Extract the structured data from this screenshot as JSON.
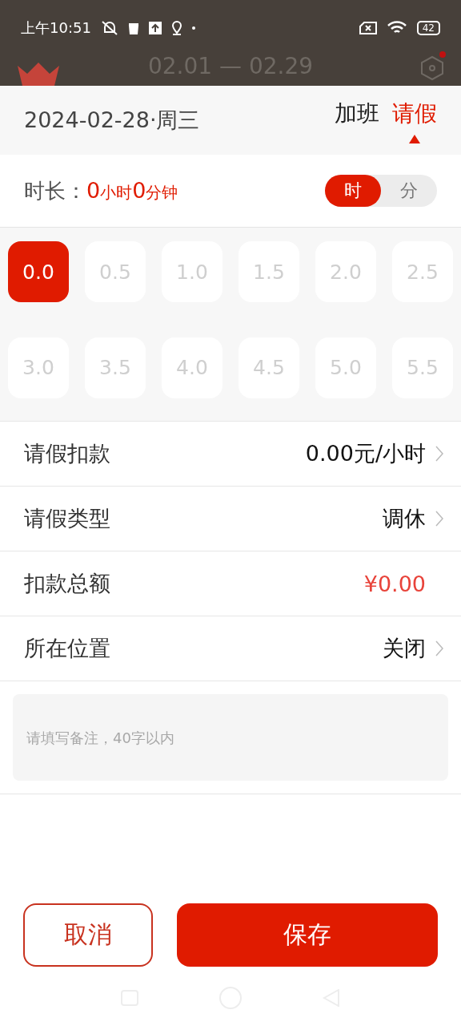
{
  "status_bar": {
    "time": "上午10:51",
    "battery": "42"
  },
  "period": "02.01 — 02.29",
  "header": {
    "date": "2024-02-28·周三",
    "tabs": [
      {
        "label": "加班",
        "selected": false
      },
      {
        "label": "请假",
        "selected": true
      }
    ]
  },
  "duration": {
    "label": "时长：",
    "parts": [
      {
        "text": "0",
        "kind": "number"
      },
      {
        "text": "小时",
        "kind": "unit"
      },
      {
        "text": "0",
        "kind": "number"
      },
      {
        "text": "分钟",
        "kind": "unit"
      }
    ],
    "unit_toggle": [
      {
        "label": "时",
        "selected": true
      },
      {
        "label": "分",
        "selected": false
      }
    ]
  },
  "hours": [
    {
      "label": "0.0",
      "selected": true
    },
    {
      "label": "0.5",
      "selected": false
    },
    {
      "label": "1.0",
      "selected": false
    },
    {
      "label": "1.5",
      "selected": false
    },
    {
      "label": "2.0",
      "selected": false
    },
    {
      "label": "2.5",
      "selected": false
    },
    {
      "label": "3.0",
      "selected": false
    },
    {
      "label": "3.5",
      "selected": false
    },
    {
      "label": "4.0",
      "selected": false
    },
    {
      "label": "4.5",
      "selected": false
    },
    {
      "label": "5.0",
      "selected": false
    },
    {
      "label": "5.5",
      "selected": false
    }
  ],
  "rows": [
    {
      "label": "请假扣款",
      "value": "0.00元/小时",
      "kind": "link"
    },
    {
      "label": "请假类型",
      "value": "调休",
      "kind": "link"
    },
    {
      "label": "扣款总额",
      "value": "¥0.00",
      "kind": "amount"
    },
    {
      "label": "所在位置",
      "value": "关闭",
      "kind": "link"
    }
  ],
  "note": {
    "placeholder": "请填写备注，40字以内"
  },
  "buttons": {
    "cancel": "取消",
    "save": "保存"
  }
}
